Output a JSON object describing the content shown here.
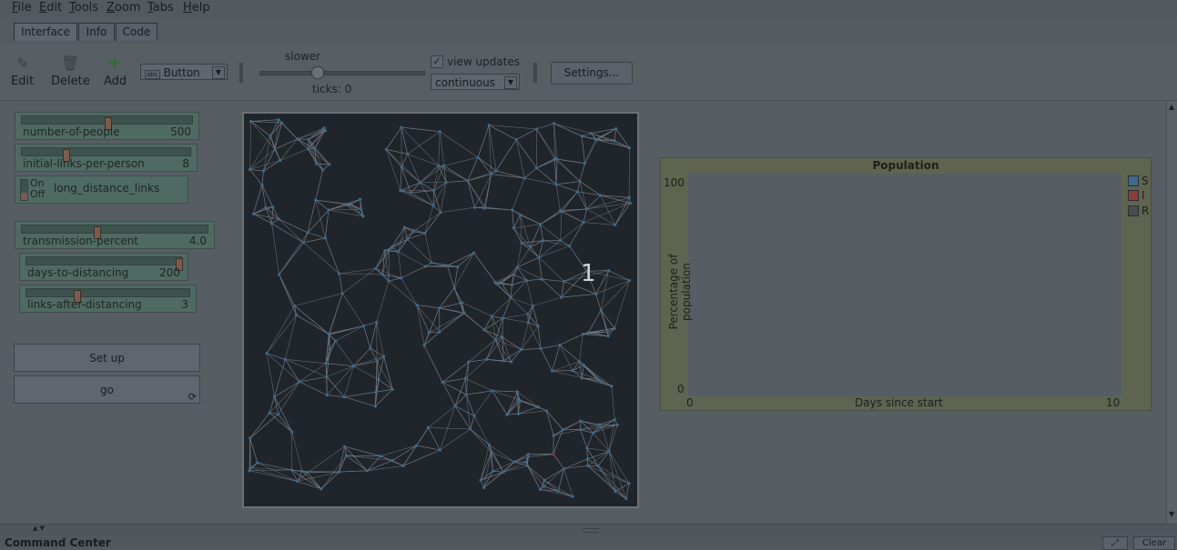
{
  "menu": [
    "File",
    "Edit",
    "Tools",
    "Zoom",
    "Tabs",
    "Help"
  ],
  "tabs": [
    "Interface",
    "Info",
    "Code"
  ],
  "toolbar": {
    "edit_label": "Edit",
    "delete_label": "Delete",
    "add_label": "Add",
    "widget_type": "Button",
    "widget_type_icon_text": "abc",
    "speed_label": "slower",
    "ticks_label": "ticks: 0",
    "view_updates_label": "view updates",
    "view_updates_checked": true,
    "update_mode": "continuous",
    "settings_label": "Settings..."
  },
  "widgets": {
    "number_of_people": {
      "name": "number-of-people",
      "value": "500",
      "level": 0.5
    },
    "initial_links": {
      "name": "initial-links-per-person",
      "value": "8",
      "level": 0.25
    },
    "long_distance": {
      "on_label": "On",
      "off_label": "Off",
      "name": "long_distance_links",
      "state": "off"
    },
    "transmission": {
      "name": "transmission-percent",
      "value": "4.0",
      "level": 0.4
    },
    "days_to_distancing": {
      "name": "days-to-distancing",
      "value": "200",
      "level": 1.0
    },
    "links_after": {
      "name": "links-after-distancing",
      "value": "3",
      "level": 0.3
    },
    "setup_label": "Set up",
    "go_label": "go"
  },
  "world": {
    "overlay_number": "1"
  },
  "chart_data": {
    "type": "line",
    "title": "Population",
    "xlabel": "Days since start",
    "ylabel": "Percentage of population",
    "xlim": [
      0,
      10
    ],
    "ylim": [
      0,
      100
    ],
    "x_tick_labels": [
      "0",
      "10"
    ],
    "y_tick_labels": [
      "0",
      "100"
    ],
    "legend_position": "right",
    "series": [
      {
        "name": "S",
        "color": "#3d6a8a",
        "values": []
      },
      {
        "name": "I",
        "color": "#8a3d3d",
        "values": []
      },
      {
        "name": "R",
        "color": "#4a4d50",
        "values": []
      }
    ]
  },
  "command_center": {
    "title": "Command Center",
    "clear_label": "Clear",
    "expand_icon": "expand-icon"
  }
}
